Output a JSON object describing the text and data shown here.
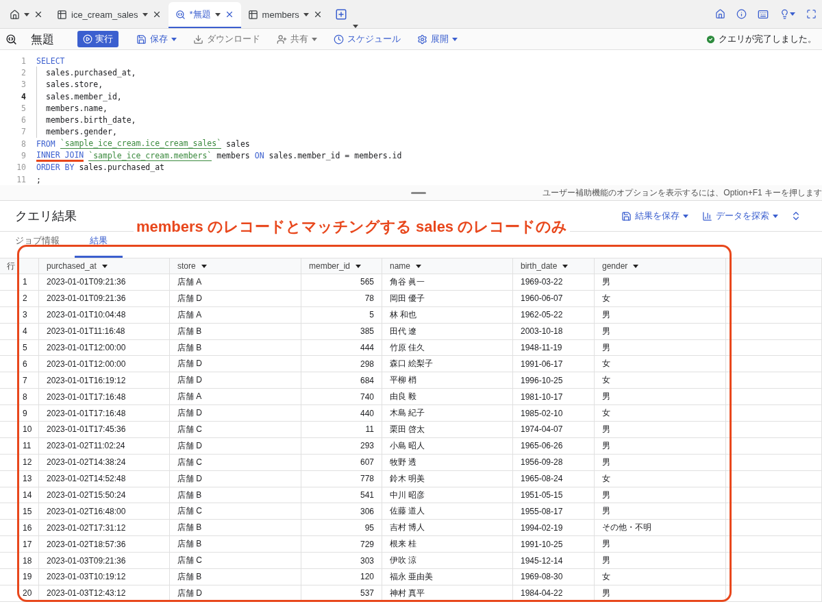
{
  "tabs": [
    {
      "kind": "home",
      "selected": false
    },
    {
      "kind": "table",
      "label": "ice_cream_sales",
      "selected": false
    },
    {
      "kind": "query",
      "label": "*無題",
      "selected": true
    },
    {
      "kind": "table",
      "label": "members",
      "selected": false
    }
  ],
  "toolbar": {
    "title": "無題",
    "run": "実行",
    "actions": [
      {
        "kind": "save",
        "label": "保存",
        "menu": true,
        "disabled": false
      },
      {
        "kind": "download",
        "label": "ダウンロード",
        "menu": false,
        "disabled": true
      },
      {
        "kind": "share",
        "label": "共有",
        "menu": true,
        "disabled": true
      },
      {
        "kind": "schedule",
        "label": "スケジュール",
        "menu": false,
        "disabled": false
      },
      {
        "kind": "deploy",
        "label": "展開",
        "menu": true,
        "disabled": false
      }
    ],
    "status": "クエリが完了しました。"
  },
  "editor": {
    "lines": [
      {
        "number": "1",
        "current": false,
        "indented": false,
        "tokens": [
          {
            "kind": "keyword",
            "text": "SELECT"
          }
        ]
      },
      {
        "number": "2",
        "current": false,
        "indented": true,
        "tokens": [
          {
            "kind": "plain",
            "text": "sales.purchased_at,"
          }
        ]
      },
      {
        "number": "3",
        "current": false,
        "indented": true,
        "tokens": [
          {
            "kind": "plain",
            "text": "sales.store,"
          }
        ]
      },
      {
        "number": "4",
        "current": true,
        "indented": true,
        "tokens": [
          {
            "kind": "plain",
            "text": "sales.member_id,"
          }
        ]
      },
      {
        "number": "5",
        "current": false,
        "indented": true,
        "tokens": [
          {
            "kind": "plain",
            "text": "members.name,"
          }
        ]
      },
      {
        "number": "6",
        "current": false,
        "indented": true,
        "tokens": [
          {
            "kind": "plain",
            "text": "members.birth_date,"
          }
        ]
      },
      {
        "number": "7",
        "current": false,
        "indented": true,
        "tokens": [
          {
            "kind": "plain",
            "text": "members.gender,"
          }
        ]
      },
      {
        "number": "8",
        "current": false,
        "indented": false,
        "tokens": [
          {
            "kind": "keyword",
            "text": "FROM"
          },
          {
            "kind": "string",
            "text": "`sample_ice_cream.ice_cream_sales`"
          },
          {
            "kind": "plain",
            "text": "sales"
          }
        ]
      },
      {
        "number": "9",
        "current": false,
        "indented": false,
        "tokens": [
          {
            "kind": "keyword",
            "text": "INNER JOIN",
            "annotated": true
          },
          {
            "kind": "string",
            "text": "`sample_ice_cream.members`"
          },
          {
            "kind": "plain",
            "text": "members"
          },
          {
            "kind": "keyword",
            "text": "ON"
          },
          {
            "kind": "plain",
            "text": "sales.member_id = members.id"
          }
        ]
      },
      {
        "number": "10",
        "current": false,
        "indented": false,
        "tokens": [
          {
            "kind": "keyword",
            "text": "ORDER BY"
          },
          {
            "kind": "plain",
            "text": "sales.purchased_at"
          }
        ]
      },
      {
        "number": "11",
        "current": false,
        "indented": false,
        "tokens": [
          {
            "kind": "plain",
            "text": ";"
          }
        ]
      }
    ],
    "hint": "ユーザー補助機能のオプションを表示するには、Option+F1 キーを押します"
  },
  "results": {
    "title": "クエリ結果",
    "actions": [
      {
        "kind": "save",
        "label": "結果を保存"
      },
      {
        "kind": "explore",
        "label": "データを探索"
      }
    ],
    "tabs": [
      {
        "label": "ジョブ情報",
        "selected": false
      },
      {
        "label": "結果",
        "selected": true
      }
    ],
    "annotation": "members のレコードとマッチングする sales のレコードのみ",
    "table": {
      "columns": [
        {
          "label": "行",
          "kind": "index"
        },
        {
          "label": "purchased_at",
          "kind": "text"
        },
        {
          "label": "store",
          "kind": "text"
        },
        {
          "label": "member_id",
          "kind": "number"
        },
        {
          "label": "name",
          "kind": "text"
        },
        {
          "label": "birth_date",
          "kind": "text"
        },
        {
          "label": "gender",
          "kind": "text"
        }
      ],
      "rows": [
        [
          "1",
          "2023-01-01T09:21:36",
          "店舗 A",
          "565",
          "角谷 眞一",
          "1969-03-22",
          "男"
        ],
        [
          "2",
          "2023-01-01T09:21:36",
          "店舗 D",
          "78",
          "岡田 優子",
          "1960-06-07",
          "女"
        ],
        [
          "3",
          "2023-01-01T10:04:48",
          "店舗 A",
          "5",
          "林 和也",
          "1962-05-22",
          "男"
        ],
        [
          "4",
          "2023-01-01T11:16:48",
          "店舗 B",
          "385",
          "田代 遼",
          "2003-10-18",
          "男"
        ],
        [
          "5",
          "2023-01-01T12:00:00",
          "店舗 B",
          "444",
          "竹原 佳久",
          "1948-11-19",
          "男"
        ],
        [
          "6",
          "2023-01-01T12:00:00",
          "店舗 D",
          "298",
          "森口 絵梨子",
          "1991-06-17",
          "女"
        ],
        [
          "7",
          "2023-01-01T16:19:12",
          "店舗 D",
          "684",
          "平柳 梢",
          "1996-10-25",
          "女"
        ],
        [
          "8",
          "2023-01-01T17:16:48",
          "店舗 A",
          "740",
          "由良 毅",
          "1981-10-17",
          "男"
        ],
        [
          "9",
          "2023-01-01T17:16:48",
          "店舗 D",
          "440",
          "木島 紀子",
          "1985-02-10",
          "女"
        ],
        [
          "10",
          "2023-01-01T17:45:36",
          "店舗 C",
          "11",
          "栗田 啓太",
          "1974-04-07",
          "男"
        ],
        [
          "11",
          "2023-01-02T11:02:24",
          "店舗 D",
          "293",
          "小島 昭人",
          "1965-06-26",
          "男"
        ],
        [
          "12",
          "2023-01-02T14:38:24",
          "店舗 C",
          "607",
          "牧野 透",
          "1956-09-28",
          "男"
        ],
        [
          "13",
          "2023-01-02T14:52:48",
          "店舗 D",
          "778",
          "鈴木 明美",
          "1965-08-24",
          "女"
        ],
        [
          "14",
          "2023-01-02T15:50:24",
          "店舗 B",
          "541",
          "中川 昭彦",
          "1951-05-15",
          "男"
        ],
        [
          "15",
          "2023-01-02T16:48:00",
          "店舗 C",
          "306",
          "佐藤 道人",
          "1955-08-17",
          "男"
        ],
        [
          "16",
          "2023-01-02T17:31:12",
          "店舗 B",
          "95",
          "吉村 博人",
          "1994-02-19",
          "その他・不明"
        ],
        [
          "17",
          "2023-01-02T18:57:36",
          "店舗 B",
          "729",
          "根来 桂",
          "1991-10-25",
          "男"
        ],
        [
          "18",
          "2023-01-03T09:21:36",
          "店舗 C",
          "303",
          "伊吹 涼",
          "1945-12-14",
          "男"
        ],
        [
          "19",
          "2023-01-03T10:19:12",
          "店舗 B",
          "120",
          "福永 亜由美",
          "1969-08-30",
          "女"
        ],
        [
          "20",
          "2023-01-03T12:43:12",
          "店舗 D",
          "537",
          "神村 真平",
          "1984-04-22",
          "男"
        ]
      ]
    }
  }
}
